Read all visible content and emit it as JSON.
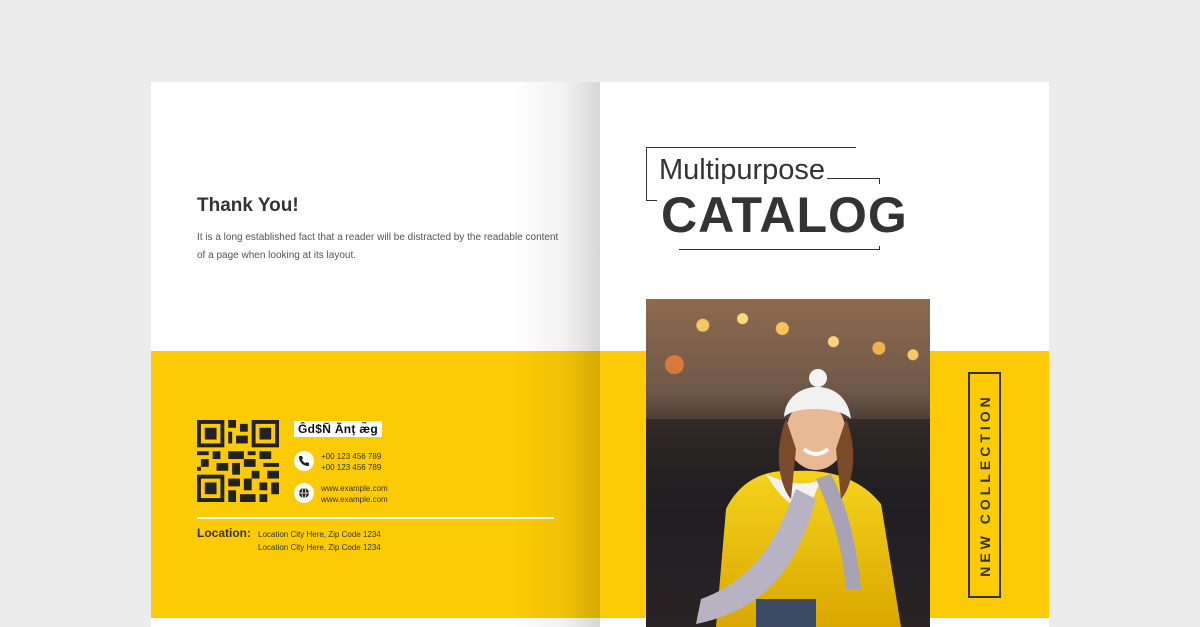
{
  "left_page": {
    "heading": "Thank You!",
    "body": "It is a long established fact that a reader will be distracted by the readable content of a page when looking at its layout.",
    "company_name": "Ĝd$Ñ Ãnț æ̃g",
    "phone_lines": [
      "+00 123 456 789",
      "+00 123 456 789"
    ],
    "web_lines": [
      "www.example.com",
      "www.example.com"
    ],
    "location_label": "Location:",
    "location_lines": [
      "Location City Here, Zip Code 1234",
      "Location City Here, Zip Code 1234"
    ],
    "icons": [
      "qr-code",
      "phone-icon",
      "globe-icon"
    ]
  },
  "right_page": {
    "title_line1": "Multipurpose",
    "title_line2": "CATALOG",
    "side_label": "NEW COLLECTION",
    "photo": "woman-in-yellow-jacket-photo"
  },
  "colors": {
    "accent": "#fccb06",
    "text_dark": "#333333",
    "background": "#ececec"
  }
}
